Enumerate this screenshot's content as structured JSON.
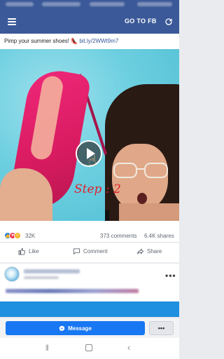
{
  "header": {
    "go_to_fb_label": "GO TO FB",
    "hamburger_icon": "hamburger-menu-icon",
    "refresh_icon": "refresh-icon",
    "bar_color": "#3b5998"
  },
  "post": {
    "text_prefix": "Pimp your summer shoes!",
    "text_emoji": "👠",
    "link": "bit.ly/2WWt9m7",
    "overlay_step_text": "Step : 2",
    "play_icon": "play-button-icon",
    "stats": {
      "reaction_count": "32K",
      "comments": "373 comments",
      "shares": "6.4K shares"
    },
    "actions": {
      "like": "Like",
      "comment": "Comment",
      "share": "Share"
    }
  },
  "bottom_bar": {
    "message_label": "Message",
    "more_label": "•••",
    "message_color": "#1877f2"
  },
  "nav": {
    "menu_glyph": "⦀",
    "back_glyph": "‹"
  }
}
